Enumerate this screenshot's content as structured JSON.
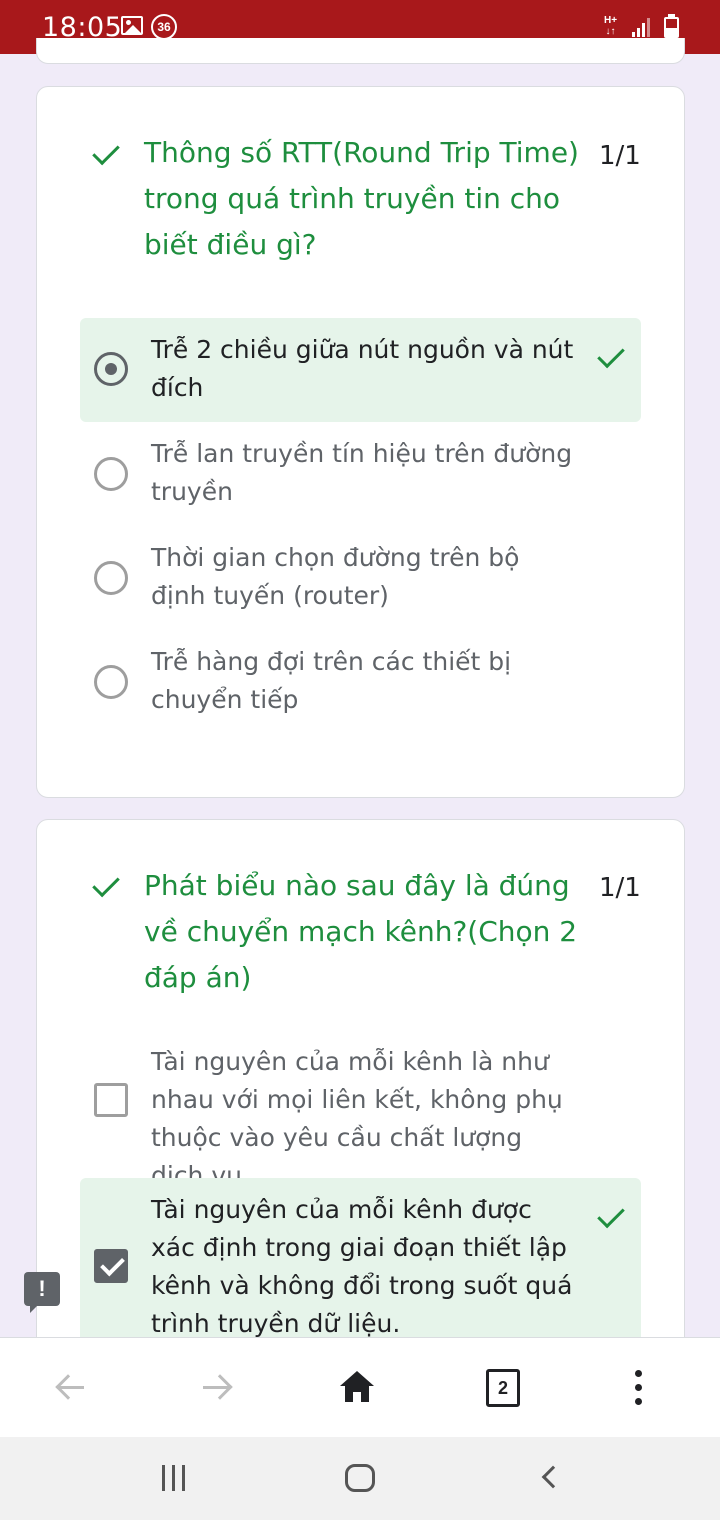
{
  "status_bar": {
    "time": "18:05",
    "notification_badge": "36",
    "network_type": "H+",
    "icons": [
      "gallery-icon",
      "notification-count-icon",
      "network-hplus-icon",
      "signal-icon",
      "battery-icon"
    ],
    "background_color": "#a8181b"
  },
  "questions": [
    {
      "title": "Thông số RTT(Round Trip Time) trong quá trình truyền tin cho biết điều gì?",
      "score": "1/1",
      "type": "radio",
      "options": [
        {
          "text": "Trễ 2 chiều giữa nút nguồn và nút đích",
          "selected": true,
          "correct": true
        },
        {
          "text": "Trễ lan truyền tín hiệu trên đường truyền",
          "selected": false,
          "correct": false
        },
        {
          "text": "Thời gian chọn đường trên bộ định tuyến (router)",
          "selected": false,
          "correct": false
        },
        {
          "text": "Trễ hàng đợi trên các thiết bị chuyển tiếp",
          "selected": false,
          "correct": false
        }
      ]
    },
    {
      "title": "Phát biểu nào sau đây là đúng về chuyển mạch kênh?(Chọn 2 đáp án)",
      "score": "1/1",
      "type": "checkbox",
      "options": [
        {
          "text": "Tài nguyên của mỗi kênh là như nhau với mọi liên kết, không phụ thuộc vào yêu cầu chất lượng dịch vụ.",
          "selected": false,
          "correct": false
        },
        {
          "text": "Tài nguyên của mỗi kênh được xác định trong giai đoạn thiết lập kênh và không đổi trong suốt quá trình truyền dữ liệu.",
          "selected": true,
          "correct": true
        }
      ]
    }
  ],
  "feedback_button": {
    "label": "!"
  },
  "browser_toolbar": {
    "tab_count": "2",
    "icons": [
      "back-arrow-icon",
      "forward-arrow-icon",
      "home-icon",
      "tabs-icon",
      "more-vert-icon"
    ]
  },
  "system_nav": {
    "icons": [
      "recent-apps-icon",
      "home-button-icon",
      "back-icon"
    ]
  },
  "colors": {
    "page_background": "#f0ebf8",
    "correct_green": "#1e8e3e",
    "correct_fill": "#e6f4ea"
  }
}
